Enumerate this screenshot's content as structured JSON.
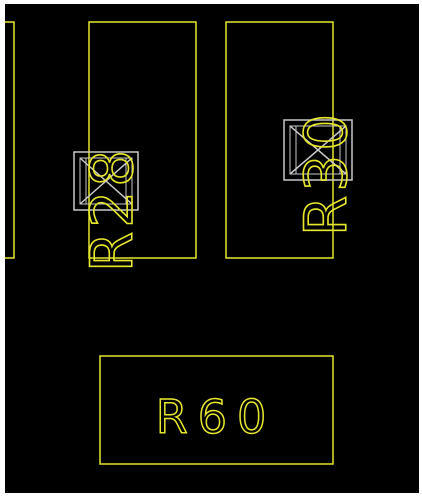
{
  "canvas": {
    "background": "#000000",
    "stroke_color": "#e6e62e",
    "marker_color": "#c8c8c8"
  },
  "components": {
    "left_partial": {
      "name": "partial-footprint-left"
    },
    "r28": {
      "label_prefix": "R",
      "label_number": "28",
      "marker_icon": "x-box-marker-icon"
    },
    "r30": {
      "label_prefix": "R",
      "label_number": "30",
      "marker_icon": "x-box-marker-icon"
    },
    "r60": {
      "label": "R60"
    }
  }
}
